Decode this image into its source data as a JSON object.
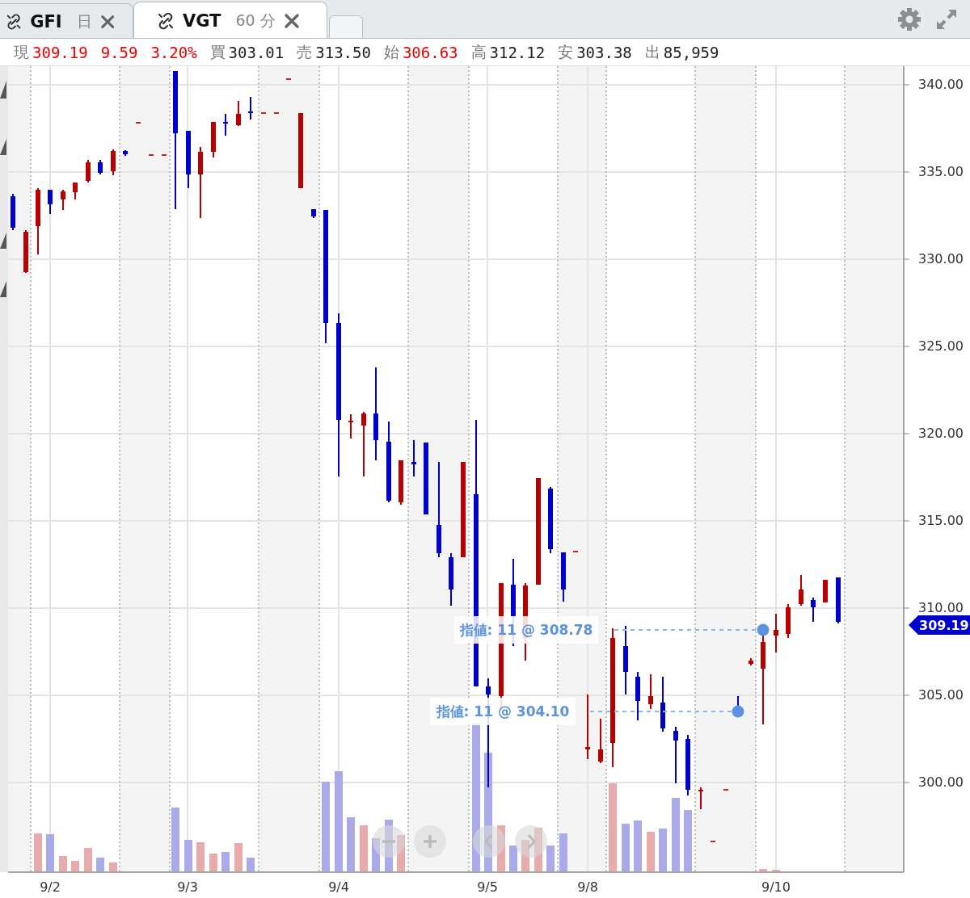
{
  "tabs": [
    {
      "symbol": "GFI",
      "interval": "日",
      "selected": false
    },
    {
      "symbol": "VGT",
      "interval": "60 分",
      "selected": true
    }
  ],
  "quote": [
    {
      "label": "現",
      "value": "309.19",
      "color": "#ee0000"
    },
    {
      "value": "9.59",
      "color": "#ee0000"
    },
    {
      "value": "3.20%",
      "color": "#ee0000"
    },
    {
      "label": "買",
      "value": "303.01",
      "color": "#222222"
    },
    {
      "label": "売",
      "value": "313.50",
      "color": "#222222"
    },
    {
      "label": "始",
      "value": "306.63",
      "color": "#ee0000"
    },
    {
      "label": "高",
      "value": "312.12",
      "color": "#222222"
    },
    {
      "label": "安",
      "value": "303.38",
      "color": "#222222"
    },
    {
      "label": "出",
      "value": "85,959",
      "color": "#222222"
    }
  ],
  "chart": {
    "price_ticks": [
      "340.00",
      "335.00",
      "330.00",
      "325.00",
      "320.00",
      "315.00",
      "310.00",
      "305.00",
      "300.00"
    ],
    "date_labels": [
      "9/2",
      "9/3",
      "9/4",
      "9/5",
      "9/8",
      "9/10"
    ],
    "last_price": "309.19",
    "orders": [
      {
        "label": "指値: 11 @ 308.78"
      },
      {
        "label": "指値: 11 @ 304.10"
      }
    ]
  }
}
